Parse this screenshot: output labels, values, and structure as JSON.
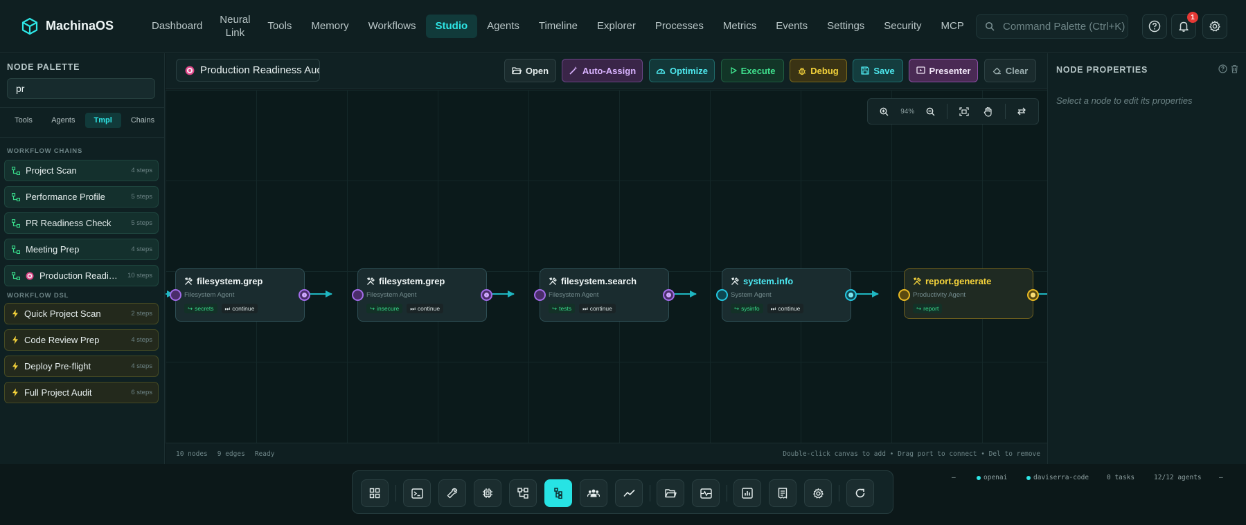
{
  "app": {
    "name": "MachinaOS"
  },
  "nav": {
    "items": [
      "Dashboard",
      "Neural Link",
      "Tools",
      "Memory",
      "Workflows",
      "Studio",
      "Agents",
      "Timeline",
      "Explorer",
      "Processes",
      "Metrics",
      "Events",
      "Settings",
      "Security",
      "MCP"
    ],
    "active": "Studio",
    "command_placeholder": "Command Palette (Ctrl+K)",
    "notification_count": "1"
  },
  "palette": {
    "title": "NODE PALETTE",
    "search_value": "pr",
    "tabs": [
      "Tools",
      "Agents",
      "Tmpl",
      "Chains"
    ],
    "active_tab": "Tmpl",
    "section_chains": "WORKFLOW CHAINS",
    "chains": [
      {
        "label": "Project Scan",
        "steps": "4 steps",
        "icon": "chain-icon"
      },
      {
        "label": "Performance Profile",
        "steps": "5 steps",
        "icon": "chain-icon"
      },
      {
        "label": "PR Readiness Check",
        "steps": "5 steps",
        "icon": "chain-icon"
      },
      {
        "label": "Meeting Prep",
        "steps": "4 steps",
        "icon": "chain-icon"
      },
      {
        "label": "Production Readiness Audit",
        "steps": "10 steps",
        "icon": "target-icon"
      }
    ],
    "section_dsl": "WORKFLOW DSL",
    "dsl": [
      {
        "label": "Quick Project Scan",
        "steps": "2 steps"
      },
      {
        "label": "Code Review Prep",
        "steps": "4 steps"
      },
      {
        "label": "Deploy Pre-flight",
        "steps": "4 steps"
      },
      {
        "label": "Full Project Audit",
        "steps": "6 steps"
      }
    ]
  },
  "toolbar": {
    "workflow_name": "Production Readiness Audit",
    "buttons": {
      "open": "Open",
      "auto_assign": "Auto-Assign",
      "optimize": "Optimize",
      "execute": "Execute",
      "debug": "Debug",
      "save": "Save",
      "presenter": "Presenter",
      "clear": "Clear"
    }
  },
  "canvas": {
    "zoom": "94%",
    "nodes": [
      {
        "title": "filesystem.grep",
        "agent": "Filesystem Agent",
        "output": "secrets",
        "flow": "continue"
      },
      {
        "title": "filesystem.grep",
        "agent": "Filesystem Agent",
        "output": "insecure",
        "flow": "continue"
      },
      {
        "title": "filesystem.search",
        "agent": "Filesystem Agent",
        "output": "tests",
        "flow": "continue"
      },
      {
        "title": "system.info",
        "agent": "System Agent",
        "output": "sysinfo",
        "flow": "continue"
      },
      {
        "title": "report.generate",
        "agent": "Productivity Agent",
        "output": "report",
        "flow": ""
      }
    ],
    "status": {
      "nodes": "10 nodes",
      "edges": "9 edges",
      "state": "Ready",
      "hint": "Double-click canvas to add • Drag port to connect • Del to remove"
    }
  },
  "properties": {
    "title": "NODE PROPERTIES",
    "hint": "Select a node to edit its properties"
  },
  "statusbar": {
    "dash": "—",
    "provider": "openai",
    "workspace": "daviserra-code",
    "tasks": "0 tasks",
    "agents": "12/12 agents",
    "dash2": "—"
  },
  "colors": {
    "accent": "#2ee6e6",
    "filesystem_port": "#a26be8",
    "system_port": "#22c6e0",
    "report_port": "#e8b923",
    "edge": "#1fb7c2"
  }
}
